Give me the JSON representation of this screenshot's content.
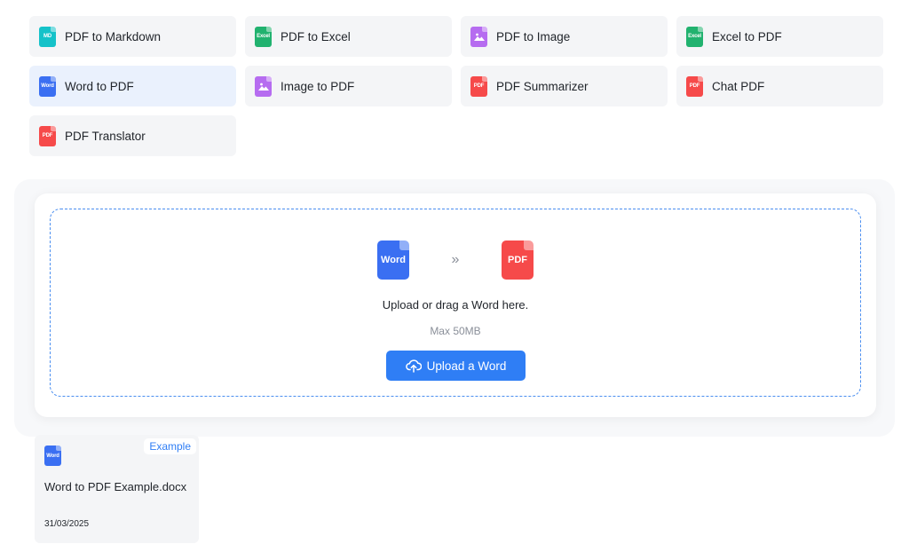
{
  "tools": [
    {
      "label": "PDF to Markdown",
      "icon": "md-file-icon",
      "icon_text": "MD",
      "color": "#15c2c9"
    },
    {
      "label": "PDF to Excel",
      "icon": "excel-file-icon",
      "icon_text": "Excel",
      "color": "#21b26f"
    },
    {
      "label": "PDF to Image",
      "icon": "image-file-icon",
      "icon_text": "",
      "color": "#b66cf0"
    },
    {
      "label": "Excel to PDF",
      "icon": "excel-file-icon",
      "icon_text": "Excel",
      "color": "#21b26f"
    },
    {
      "label": "Word to PDF",
      "icon": "word-file-icon",
      "icon_text": "Word",
      "color": "#3a6ff2",
      "active": true
    },
    {
      "label": "Image to PDF",
      "icon": "image-file-icon",
      "icon_text": "",
      "color": "#b66cf0"
    },
    {
      "label": "PDF Summarizer",
      "icon": "pdf-file-icon",
      "icon_text": "PDF",
      "color": "#f64a4a"
    },
    {
      "label": "Chat PDF",
      "icon": "pdf-file-icon",
      "icon_text": "PDF",
      "color": "#f64a4a"
    },
    {
      "label": "PDF Translator",
      "icon": "pdf-file-icon",
      "icon_text": "PDF",
      "color": "#f64a4a"
    }
  ],
  "upload": {
    "from_icon_text": "Word",
    "to_icon_text": "PDF",
    "arrow": "»",
    "drop_text": "Upload or drag a Word here.",
    "max_text": "Max 50MB",
    "button_label": "Upload a Word",
    "accent_color": "#2f7ef5"
  },
  "example": {
    "badge": "Example",
    "icon_text": "Word",
    "filename": "Word to PDF Example.docx",
    "date": "31/03/2025"
  }
}
